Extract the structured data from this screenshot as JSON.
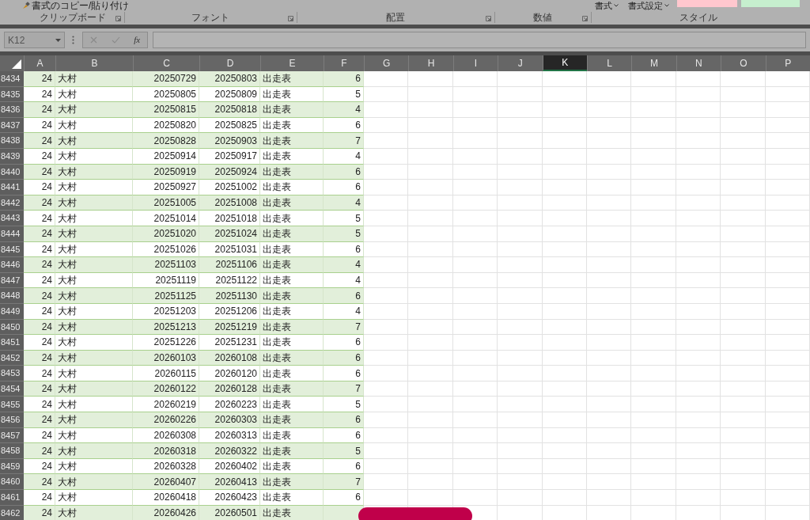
{
  "ribbon": {
    "top_items": [
      {
        "kind": "brush",
        "label": "書式のコピー/貼り付け"
      },
      {
        "kind": "dropdown",
        "label": "書式"
      },
      {
        "kind": "dropdown",
        "label": "書式設定"
      }
    ],
    "groups": [
      "クリップボード",
      "フォント",
      "配置",
      "数値",
      "スタイル"
    ]
  },
  "formula_bar": {
    "name_box": "K12",
    "fx": "fx"
  },
  "columns": [
    {
      "label": "A",
      "selected": false
    },
    {
      "label": "B",
      "selected": false
    },
    {
      "label": "C",
      "selected": false
    },
    {
      "label": "D",
      "selected": false
    },
    {
      "label": "E",
      "selected": false
    },
    {
      "label": "F",
      "selected": false
    },
    {
      "label": "G",
      "selected": false
    },
    {
      "label": "H",
      "selected": false
    },
    {
      "label": "I",
      "selected": false
    },
    {
      "label": "J",
      "selected": false
    },
    {
      "label": "K",
      "selected": true
    },
    {
      "label": "L",
      "selected": false
    },
    {
      "label": "M",
      "selected": false
    },
    {
      "label": "N",
      "selected": false
    },
    {
      "label": "O",
      "selected": false
    },
    {
      "label": "P",
      "selected": false
    }
  ],
  "rows": [
    {
      "number": "8434",
      "cells": [
        "24",
        "大村",
        "20250729",
        "20250803",
        "出走表",
        "6"
      ],
      "shaded": true
    },
    {
      "number": "8435",
      "cells": [
        "24",
        "大村",
        "20250805",
        "20250809",
        "出走表",
        "5"
      ],
      "shaded": false
    },
    {
      "number": "8436",
      "cells": [
        "24",
        "大村",
        "20250815",
        "20250818",
        "出走表",
        "4"
      ],
      "shaded": true
    },
    {
      "number": "8437",
      "cells": [
        "24",
        "大村",
        "20250820",
        "20250825",
        "出走表",
        "6"
      ],
      "shaded": false
    },
    {
      "number": "8438",
      "cells": [
        "24",
        "大村",
        "20250828",
        "20250903",
        "出走表",
        "7"
      ],
      "shaded": true
    },
    {
      "number": "8439",
      "cells": [
        "24",
        "大村",
        "20250914",
        "20250917",
        "出走表",
        "4"
      ],
      "shaded": false
    },
    {
      "number": "8440",
      "cells": [
        "24",
        "大村",
        "20250919",
        "20250924",
        "出走表",
        "6"
      ],
      "shaded": true
    },
    {
      "number": "8441",
      "cells": [
        "24",
        "大村",
        "20250927",
        "20251002",
        "出走表",
        "6"
      ],
      "shaded": false
    },
    {
      "number": "8442",
      "cells": [
        "24",
        "大村",
        "20251005",
        "20251008",
        "出走表",
        "4"
      ],
      "shaded": true
    },
    {
      "number": "8443",
      "cells": [
        "24",
        "大村",
        "20251014",
        "20251018",
        "出走表",
        "5"
      ],
      "shaded": false
    },
    {
      "number": "8444",
      "cells": [
        "24",
        "大村",
        "20251020",
        "20251024",
        "出走表",
        "5"
      ],
      "shaded": true
    },
    {
      "number": "8445",
      "cells": [
        "24",
        "大村",
        "20251026",
        "20251031",
        "出走表",
        "6"
      ],
      "shaded": false
    },
    {
      "number": "8446",
      "cells": [
        "24",
        "大村",
        "20251103",
        "20251106",
        "出走表",
        "4"
      ],
      "shaded": true
    },
    {
      "number": "8447",
      "cells": [
        "24",
        "大村",
        "20251119",
        "20251122",
        "出走表",
        "4"
      ],
      "shaded": false
    },
    {
      "number": "8448",
      "cells": [
        "24",
        "大村",
        "20251125",
        "20251130",
        "出走表",
        "6"
      ],
      "shaded": true
    },
    {
      "number": "8449",
      "cells": [
        "24",
        "大村",
        "20251203",
        "20251206",
        "出走表",
        "4"
      ],
      "shaded": false
    },
    {
      "number": "8450",
      "cells": [
        "24",
        "大村",
        "20251213",
        "20251219",
        "出走表",
        "7"
      ],
      "shaded": true
    },
    {
      "number": "8451",
      "cells": [
        "24",
        "大村",
        "20251226",
        "20251231",
        "出走表",
        "6"
      ],
      "shaded": false
    },
    {
      "number": "8452",
      "cells": [
        "24",
        "大村",
        "20260103",
        "20260108",
        "出走表",
        "6"
      ],
      "shaded": true
    },
    {
      "number": "8453",
      "cells": [
        "24",
        "大村",
        "20260115",
        "20260120",
        "出走表",
        "6"
      ],
      "shaded": false
    },
    {
      "number": "8454",
      "cells": [
        "24",
        "大村",
        "20260122",
        "20260128",
        "出走表",
        "7"
      ],
      "shaded": true
    },
    {
      "number": "8455",
      "cells": [
        "24",
        "大村",
        "20260219",
        "20260223",
        "出走表",
        "5"
      ],
      "shaded": false
    },
    {
      "number": "8456",
      "cells": [
        "24",
        "大村",
        "20260226",
        "20260303",
        "出走表",
        "6"
      ],
      "shaded": true
    },
    {
      "number": "8457",
      "cells": [
        "24",
        "大村",
        "20260308",
        "20260313",
        "出走表",
        "6"
      ],
      "shaded": false
    },
    {
      "number": "8458",
      "cells": [
        "24",
        "大村",
        "20260318",
        "20260322",
        "出走表",
        "5"
      ],
      "shaded": true
    },
    {
      "number": "8459",
      "cells": [
        "24",
        "大村",
        "20260328",
        "20260402",
        "出走表",
        "6"
      ],
      "shaded": false
    },
    {
      "number": "8460",
      "cells": [
        "24",
        "大村",
        "20260407",
        "20260413",
        "出走表",
        "7"
      ],
      "shaded": true
    },
    {
      "number": "8461",
      "cells": [
        "24",
        "大村",
        "20260418",
        "20260423",
        "出走表",
        "6"
      ],
      "shaded": false
    },
    {
      "number": "8462",
      "cells": [
        "24",
        "大村",
        "20260426",
        "20260501",
        "出走表"
      ],
      "shaded": true
    }
  ]
}
